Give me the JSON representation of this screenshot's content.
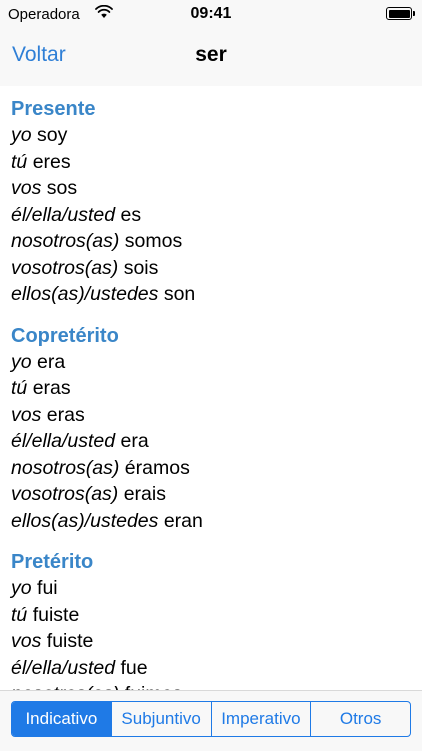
{
  "status_bar": {
    "carrier": "Operadora",
    "time": "09:41"
  },
  "nav": {
    "back_label": "Voltar",
    "title": "ser"
  },
  "sections": [
    {
      "title": "Presente",
      "forms": [
        {
          "pronoun": "yo",
          "verb": "soy"
        },
        {
          "pronoun": "tú",
          "verb": "eres"
        },
        {
          "pronoun": "vos",
          "verb": "sos"
        },
        {
          "pronoun": "él/ella/usted",
          "verb": "es"
        },
        {
          "pronoun": "nosotros(as)",
          "verb": "somos"
        },
        {
          "pronoun": "vosotros(as)",
          "verb": "sois"
        },
        {
          "pronoun": "ellos(as)/ustedes",
          "verb": "son"
        }
      ]
    },
    {
      "title": "Copretérito",
      "forms": [
        {
          "pronoun": "yo",
          "verb": "era"
        },
        {
          "pronoun": "tú",
          "verb": "eras"
        },
        {
          "pronoun": "vos",
          "verb": "eras"
        },
        {
          "pronoun": "él/ella/usted",
          "verb": "era"
        },
        {
          "pronoun": "nosotros(as)",
          "verb": "éramos"
        },
        {
          "pronoun": "vosotros(as)",
          "verb": "erais"
        },
        {
          "pronoun": "ellos(as)/ustedes",
          "verb": "eran"
        }
      ]
    },
    {
      "title": "Pretérito",
      "forms": [
        {
          "pronoun": "yo",
          "verb": "fui"
        },
        {
          "pronoun": "tú",
          "verb": "fuiste"
        },
        {
          "pronoun": "vos",
          "verb": "fuiste"
        },
        {
          "pronoun": "él/ella/usted",
          "verb": "fue"
        },
        {
          "pronoun": "nosotros(as)",
          "verb": "fuimos"
        }
      ]
    }
  ],
  "tabs": [
    {
      "label": "Indicativo",
      "active": true
    },
    {
      "label": "Subjuntivo",
      "active": false
    },
    {
      "label": "Imperativo",
      "active": false
    },
    {
      "label": "Otros",
      "active": false
    }
  ]
}
